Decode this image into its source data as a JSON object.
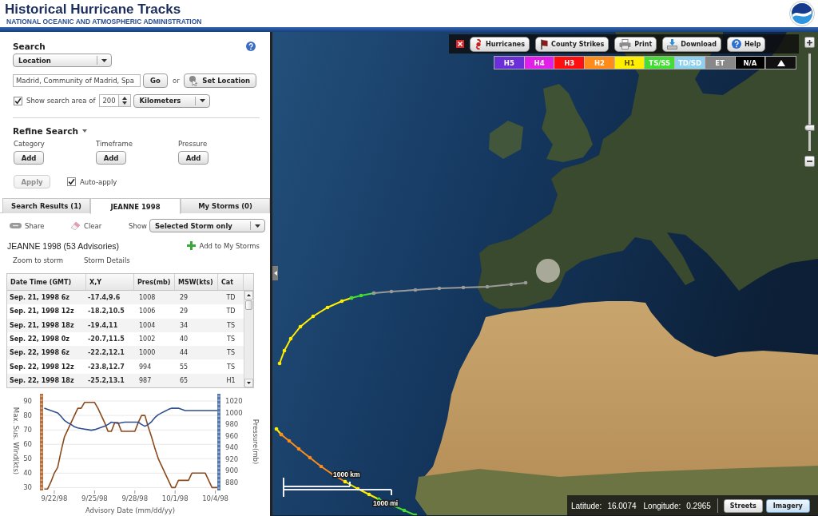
{
  "header": {
    "title": "Historical Hurricane Tracks",
    "subtitle": "NATIONAL OCEANIC AND ATMOSPHERIC ADMINISTRATION"
  },
  "search": {
    "heading": "Search",
    "mode": "Location",
    "location": "Madrid, Community of Madrid, Spa",
    "go": "Go",
    "or": "or",
    "set_location": "Set Location",
    "show_area": {
      "checked": true,
      "label": "Show search area of",
      "value": "200",
      "unit": "Kilometers"
    }
  },
  "refine": {
    "heading": "Refine Search",
    "filters": [
      {
        "label": "Category",
        "button": "Add"
      },
      {
        "label": "Timeframe",
        "button": "Add"
      },
      {
        "label": "Pressure",
        "button": "Add"
      }
    ],
    "apply": {
      "label": "Apply",
      "disabled": true
    },
    "auto_apply": {
      "label": "Auto-apply",
      "checked": true
    }
  },
  "tabs": [
    {
      "label": "Search Results (1)",
      "selected": false
    },
    {
      "label": "JEANNE 1998",
      "selected": true
    },
    {
      "label": "My Storms (0)",
      "selected": false
    }
  ],
  "storm_toolbar": {
    "share": "Share",
    "clear": "Clear",
    "show_label": "Show",
    "show_value": "Selected Storm only"
  },
  "storm": {
    "title": "JEANNE 1998 (53 Advisories)",
    "add": "Add to My Storms",
    "links": [
      "Zoom to storm",
      "Storm Details"
    ]
  },
  "table": {
    "columns": [
      "Date Time (GMT)",
      "X,Y",
      "Pres(mb)",
      "MSW(kts)",
      "Cat"
    ],
    "rows": [
      [
        "Sep. 21, 1998 6z",
        "-17.4,9.6",
        "1008",
        "29",
        "TD"
      ],
      [
        "Sep. 21, 1998 12z",
        "-18.2,10.5",
        "1006",
        "29",
        "TD"
      ],
      [
        "Sep. 21, 1998 18z",
        "-19.4,11",
        "1004",
        "34",
        "TS"
      ],
      [
        "Sep. 22, 1998 0z",
        "-20.7,11.5",
        "1002",
        "40",
        "TS"
      ],
      [
        "Sep. 22, 1998 6z",
        "-22.2,12.1",
        "1000",
        "44",
        "TS"
      ],
      [
        "Sep. 22, 1998 12z",
        "-23.8,12.7",
        "994",
        "55",
        "TS"
      ],
      [
        "Sep. 22, 1998 18z",
        "-25.2,13.1",
        "987",
        "65",
        "H1"
      ]
    ]
  },
  "chart": {
    "chart_data": {
      "type": "line",
      "xlabel": "Advisory Date (mm/dd/yy)",
      "ylabel": "Max. Sus. Wind(kts)",
      "y2label": "Pressure(mb)",
      "grid": true,
      "categories": [
        null,
        null,
        null,
        "9/22/98",
        null,
        null,
        null,
        null,
        null,
        null,
        null,
        null,
        null,
        null,
        null,
        "9/25/98",
        null,
        null,
        null,
        null,
        null,
        null,
        null,
        null,
        null,
        null,
        null,
        "9/28/98",
        null,
        null,
        null,
        null,
        null,
        null,
        null,
        null,
        null,
        null,
        null,
        "10/1/98",
        null,
        null,
        null,
        null,
        null,
        null,
        null,
        null,
        null,
        null,
        null,
        "10/4/98",
        null
      ],
      "ylim": [
        28,
        95
      ],
      "yticks": [
        30,
        40,
        50,
        60,
        70,
        80,
        90
      ],
      "y2lim": [
        866,
        1033
      ],
      "y2ticks": [
        880,
        900,
        920,
        940,
        960,
        980,
        1000,
        1020
      ],
      "series": [
        {
          "color": "#8b4a1c",
          "values": [
            29,
            29,
            34,
            40,
            44,
            55,
            65,
            70,
            75,
            80,
            85,
            85,
            89,
            89,
            89,
            89,
            85,
            80,
            75,
            69,
            69,
            75,
            75,
            69,
            69,
            69,
            69,
            69,
            75,
            80,
            80,
            72,
            65,
            57,
            50,
            45,
            40,
            35,
            30,
            30,
            35,
            35,
            35,
            35,
            40,
            40,
            40,
            40,
            40,
            35,
            30,
            30,
            30
          ]
        },
        {
          "color": "#2f4f8f",
          "axis": "y2",
          "values": [
            1008,
            1006,
            1004,
            1002,
            1000,
            994,
            987,
            983,
            980,
            976,
            974,
            973,
            972,
            971,
            970,
            971,
            973,
            975,
            977,
            980,
            984,
            983,
            982,
            983,
            984,
            984,
            984,
            984,
            984,
            980,
            977,
            980,
            985,
            992,
            997,
            1000,
            1003,
            1006,
            1008,
            1008,
            1008,
            1006,
            1004,
            1004,
            1004,
            1004,
            1004,
            1004,
            1004,
            1004,
            1004,
            1004,
            1004
          ]
        }
      ]
    }
  },
  "map": {
    "toolbar": [
      {
        "label": "Hurricanes",
        "kind": "hurricanes"
      },
      {
        "label": "County Strikes",
        "kind": "strikes"
      },
      {
        "label": "Print",
        "kind": "print"
      },
      {
        "label": "Download",
        "kind": "download"
      },
      {
        "label": "Help",
        "kind": "help"
      }
    ],
    "legend": [
      {
        "label": "H5",
        "color": "#6a2fd6"
      },
      {
        "label": "H4",
        "color": "#e020e8"
      },
      {
        "label": "H3",
        "color": "#ff1010"
      },
      {
        "label": "H2",
        "color": "#ff8c1a"
      },
      {
        "label": "H1",
        "color": "#ffee00"
      },
      {
        "label": "TS/SS",
        "color": "#44dd33"
      },
      {
        "label": "TD/SD",
        "color": "#8ed0f0"
      },
      {
        "label": "ET",
        "color": "#888888"
      },
      {
        "label": "N/A",
        "color": "#000000"
      }
    ],
    "zoom": {
      "level": 0.22
    },
    "scale": {
      "km": "1000 km",
      "mi": "1000 mi"
    },
    "coordinates": {
      "lat_label": "Latitude:",
      "lat": "16.0074",
      "lon_label": "Longitude:",
      "lon": "0.2965"
    },
    "basemaps": [
      {
        "label": "Streets",
        "selected": false
      },
      {
        "label": "Imagery",
        "selected": true
      }
    ]
  }
}
